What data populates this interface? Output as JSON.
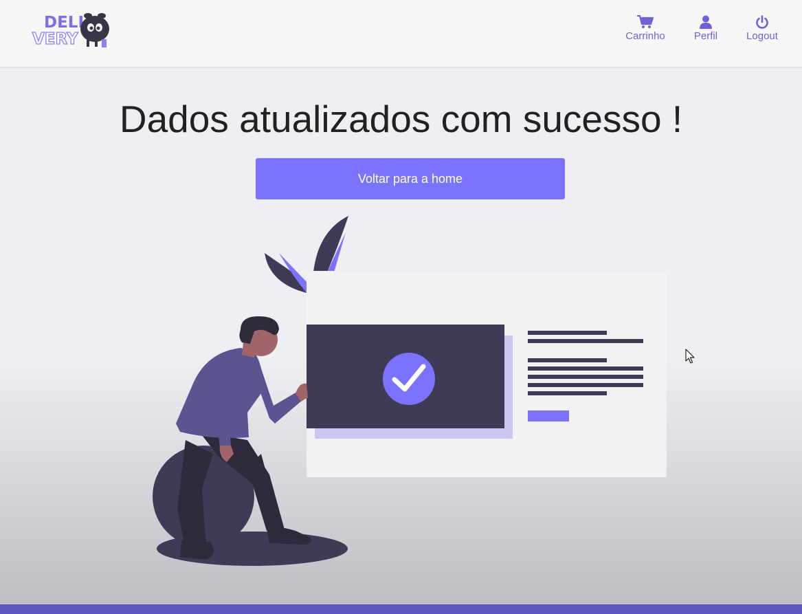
{
  "logo": {
    "line1": "DELI",
    "line2": "VERY",
    "icon": "mascot-logo"
  },
  "nav": {
    "cart": {
      "label": "Carrinho",
      "icon": "cart-icon"
    },
    "profile": {
      "label": "Perfil",
      "icon": "user-icon"
    },
    "logout": {
      "label": "Logout",
      "icon": "power-icon"
    }
  },
  "main": {
    "title": "Dados atualizados com sucesso !",
    "button_label": "Voltar para a home"
  },
  "illustration": {
    "icon": "success-checkmark-illustration"
  },
  "colors": {
    "accent": "#7b73fe",
    "nav": "#6d62d8",
    "dark": "#3f3a55",
    "bottom_bar": "#5b54c1"
  }
}
